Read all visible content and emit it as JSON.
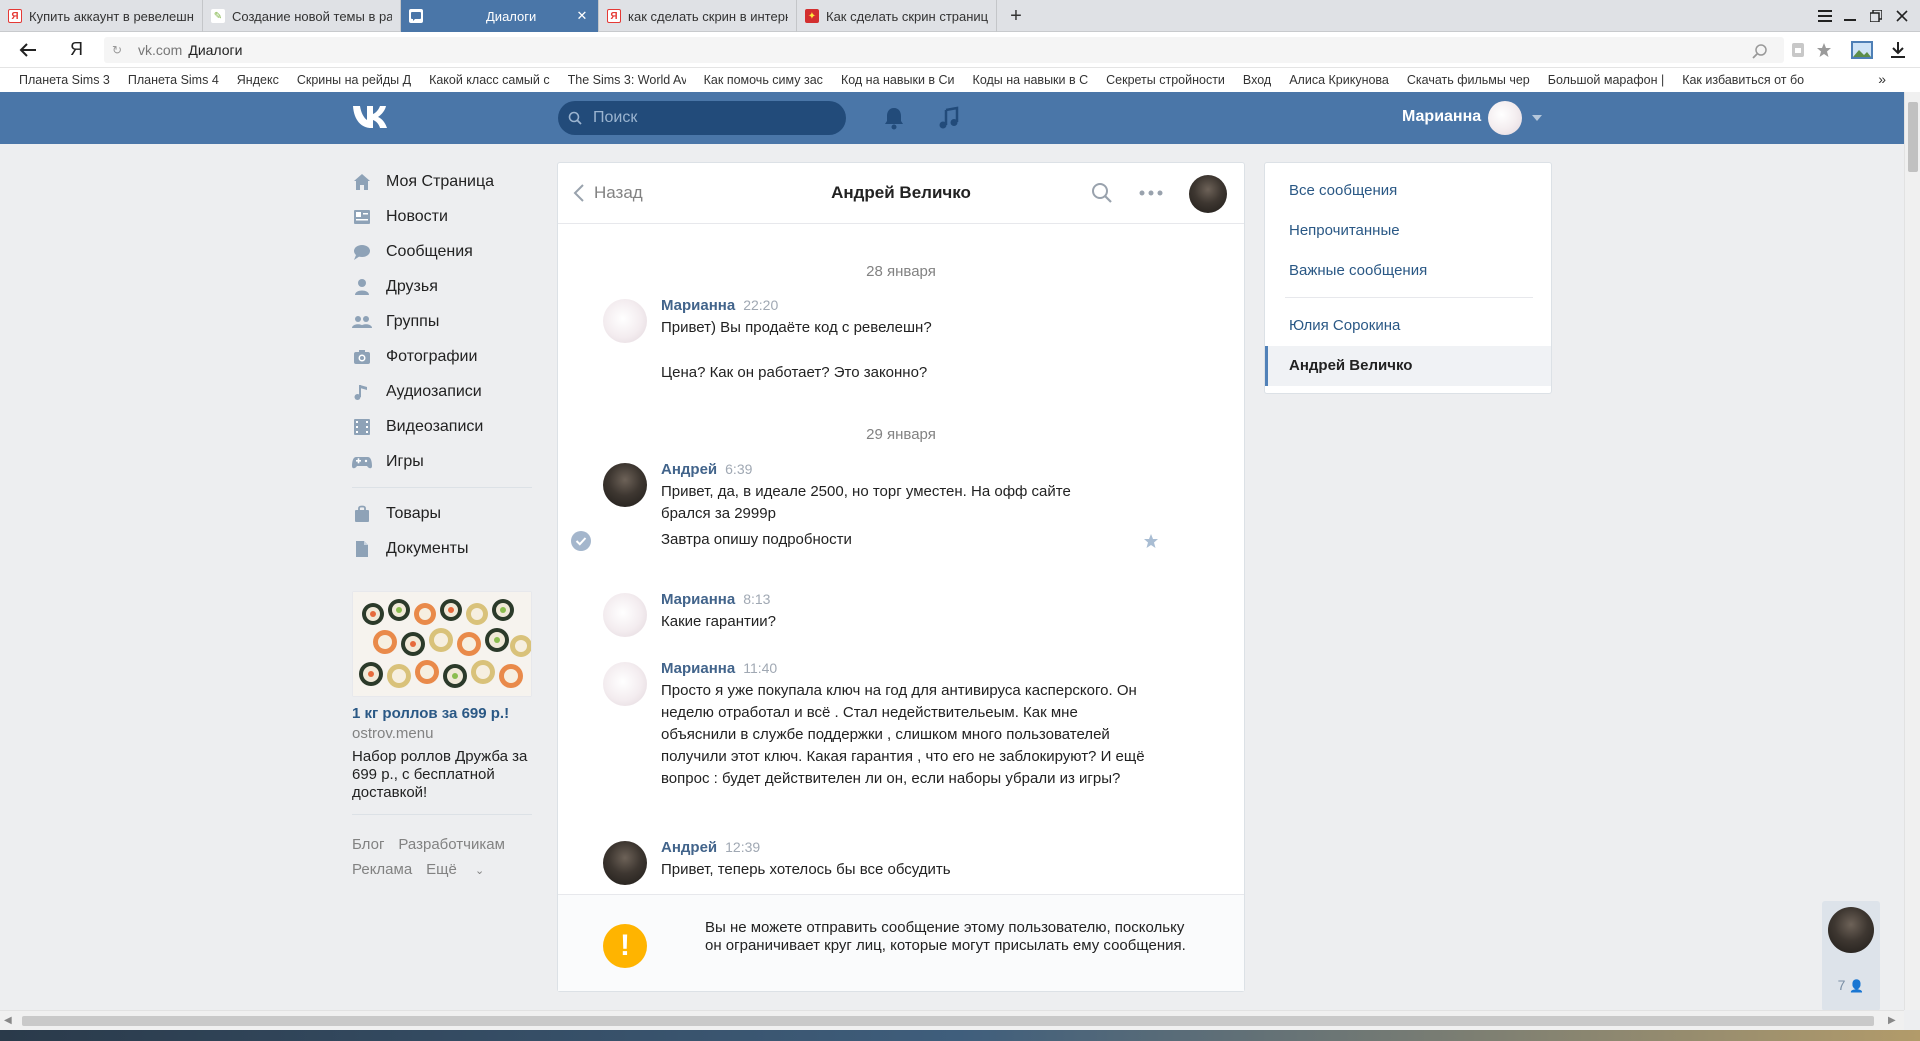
{
  "browser": {
    "tabs": [
      {
        "title": "Купить аккаунт в ревелешн",
        "favicon": "Я",
        "color": "#e53935"
      },
      {
        "title": "Создание новой темы в ра",
        "favicon": "✎",
        "color": "#7cb342"
      },
      {
        "title": "Диалоги",
        "favicon": "▪",
        "color": "#4a76a8",
        "active": true
      },
      {
        "title": "как сделать скрин в интерн",
        "favicon": "Я",
        "color": "#e53935"
      },
      {
        "title": "Как сделать скрин страниц",
        "favicon": "✦",
        "color": "#d32f2f"
      }
    ],
    "address": {
      "domain": "vk.com",
      "page": "Диалоги"
    },
    "bookmarks": [
      "Планета Sims 3",
      "Планета Sims 4",
      "Яндекс",
      "Скрины на рейды Д",
      "Какой класс самый с",
      "The Sims 3: World Av",
      "Как помочь симу зас",
      "Код на навыки в Си",
      "Коды на навыки в С",
      "Секреты стройности",
      "Вход",
      "Алиса Крикунова",
      "Скачать фильмы чер",
      "Большой марафон |",
      "Как избавиться от бо"
    ],
    "bookmarks_more": "»"
  },
  "vk": {
    "search_placeholder": "Поиск",
    "user_name": "Марианна",
    "brand_color": "#4a76a8"
  },
  "nav": {
    "items": [
      {
        "label": "Моя Страница",
        "icon": "home-icon"
      },
      {
        "label": "Новости",
        "icon": "news-icon"
      },
      {
        "label": "Сообщения",
        "icon": "messages-icon"
      },
      {
        "label": "Друзья",
        "icon": "friends-icon"
      },
      {
        "label": "Группы",
        "icon": "groups-icon"
      },
      {
        "label": "Фотографии",
        "icon": "camera-icon"
      },
      {
        "label": "Аудиозаписи",
        "icon": "music-icon"
      },
      {
        "label": "Видеозаписи",
        "icon": "video-icon"
      },
      {
        "label": "Игры",
        "icon": "gamepad-icon"
      }
    ],
    "items2": [
      {
        "label": "Товары",
        "icon": "bag-icon"
      },
      {
        "label": "Документы",
        "icon": "document-icon"
      }
    ]
  },
  "ad": {
    "title": "1 кг роллов за 699 р.!",
    "domain": "ostrov.menu",
    "text": "Набор роллов Дружба за 699 р., с бесплатной доставкой!"
  },
  "footer": {
    "blog": "Блог",
    "dev": "Разработчикам",
    "ads": "Реклама",
    "more": "Ещё"
  },
  "chat": {
    "back": "Назад",
    "title": "Андрей Величко",
    "dates": [
      "28 января",
      "29 января"
    ],
    "messages": [
      {
        "author": "Марианна",
        "time": "22:20",
        "text": "Привет) Вы продаёте код с ревелешн?"
      },
      {
        "extra": "Цена? Как он работает? Это законно?"
      },
      {
        "author": "Андрей",
        "time": "6:39",
        "text": "Привет, да, в идеале 2500, но торг уместен. На офф сайте брался за 2999р"
      },
      {
        "extra": "Завтра опишу подробности"
      },
      {
        "author": "Марианна",
        "time": "8:13",
        "text": "Какие гарантии?"
      },
      {
        "author": "Марианна",
        "time": "11:40",
        "text": "Просто я уже покупала ключ на год для антивируса касперского. Он неделю отработал и всё . Стал недействительеым. Как мне объяснили в службе поддержки , слишком много пользователей получили этот ключ. Какая гарантия , что его не заблокируют? И ещё вопрос : будет действителен ли он, если наборы убрали из игры?"
      },
      {
        "author": "Андрей",
        "time": "12:39",
        "text": "Привет, теперь хотелось бы все обсудить"
      }
    ],
    "warning": "Вы не можете отправить сообщение этому пользователю, поскольку он ограничивает круг лиц, которые могут присылать ему сообщения.",
    "warning_icon": "!"
  },
  "right": {
    "all": "Все сообщения",
    "unread": "Непрочитанные",
    "important": "Важные сообщения",
    "conversations": [
      "Юлия Сорокина",
      "Андрей Величко"
    ]
  },
  "widget": {
    "count": "7"
  }
}
